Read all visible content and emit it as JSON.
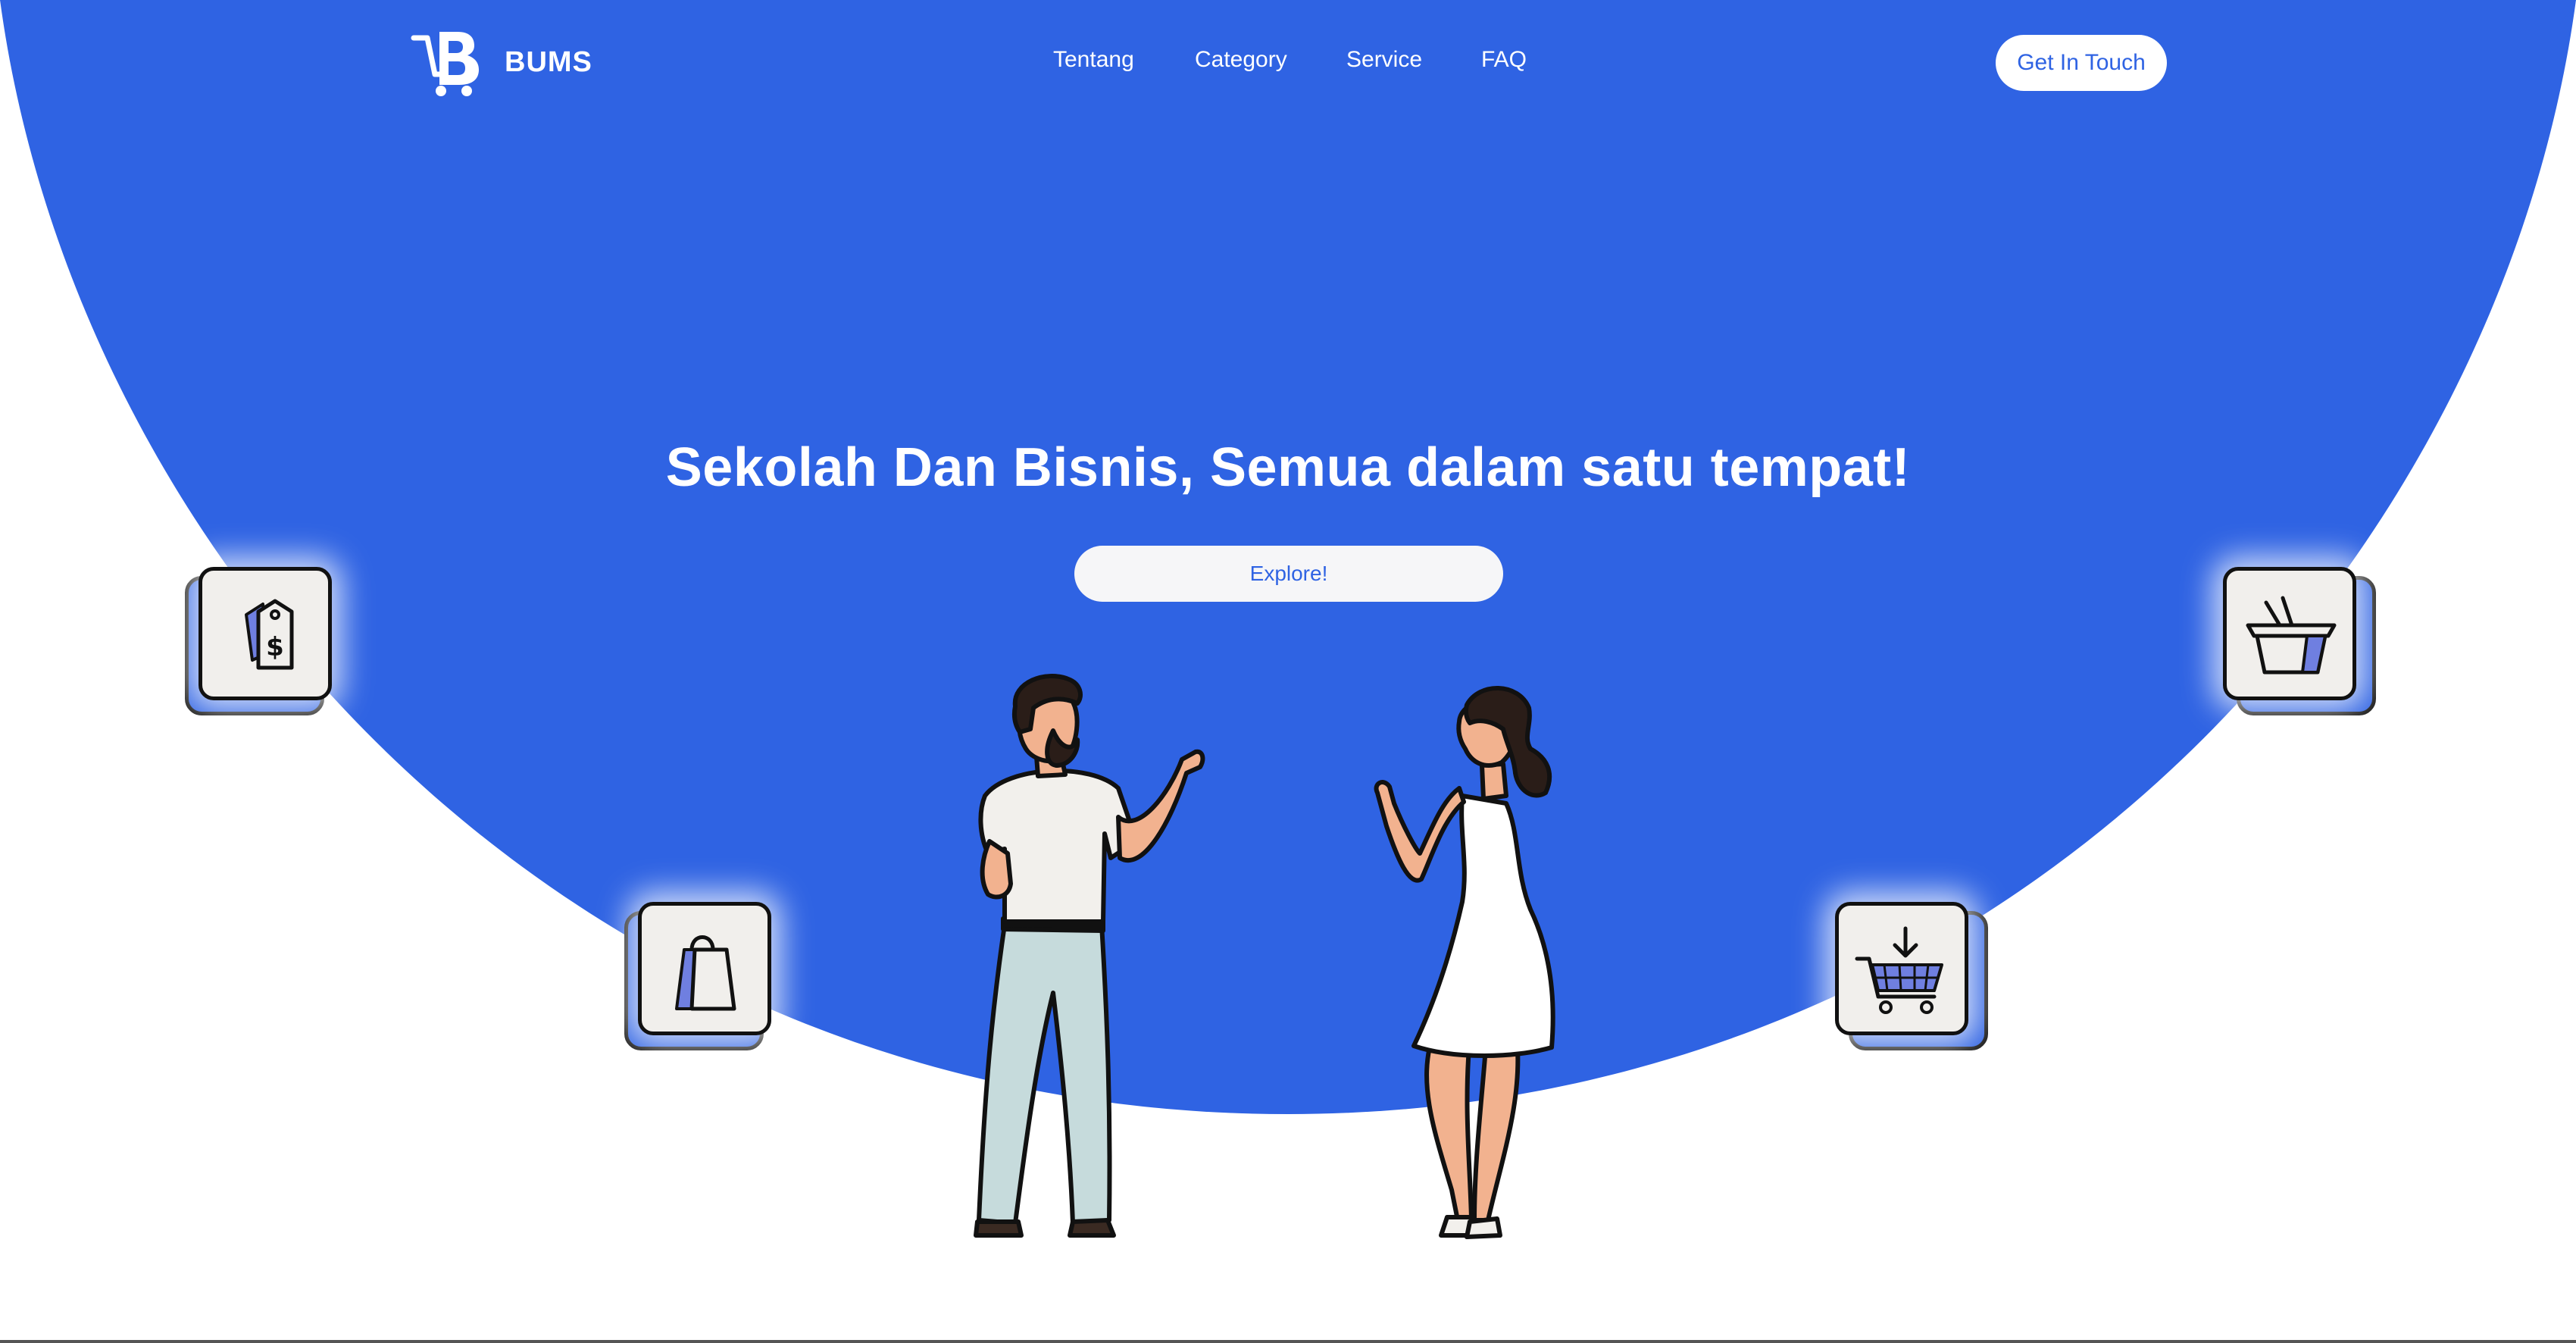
{
  "brand": {
    "name": "BUMS",
    "logo_icon": "cart-b-logo-icon"
  },
  "nav": {
    "items": [
      "Tentang",
      "Category",
      "Service",
      "FAQ"
    ]
  },
  "header": {
    "cta_label": "Get In Touch"
  },
  "hero": {
    "headline": "Sekolah Dan Bisnis, Semua dalam satu tempat!",
    "button_label": "Explore!"
  },
  "tiles": [
    {
      "icon": "price-tag-icon"
    },
    {
      "icon": "shopping-bag-icon"
    },
    {
      "icon": "basket-icon"
    },
    {
      "icon": "cart-download-icon"
    }
  ],
  "colors": {
    "primary": "#2f63e3",
    "white": "#ffffff",
    "tile": "#f1efec",
    "outline": "#111111"
  }
}
